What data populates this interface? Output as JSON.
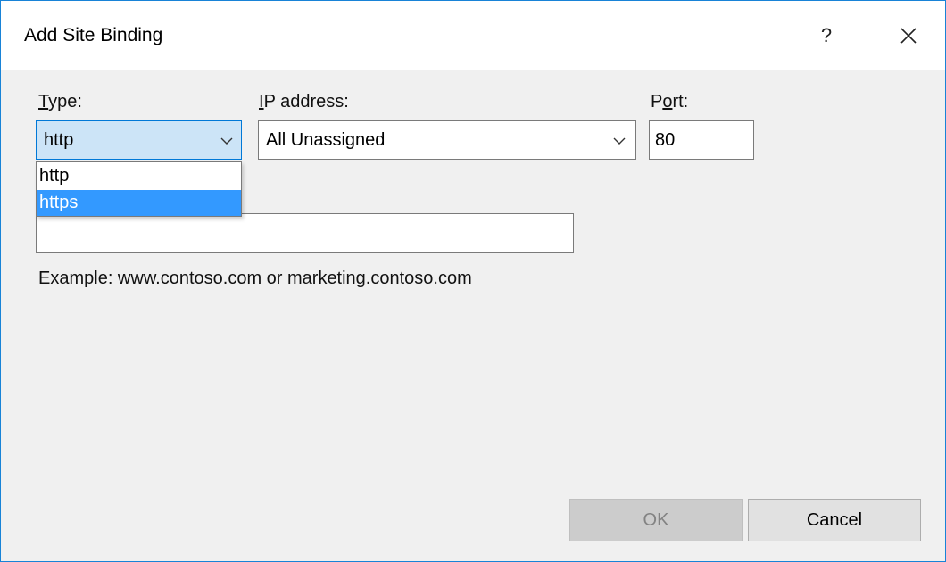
{
  "window": {
    "title": "Add Site Binding",
    "help_label": "?",
    "border_color": "#1883d7"
  },
  "type_field": {
    "label_mnemonic": "T",
    "label_rest": "ype:",
    "value": "http",
    "dropdown_open": true,
    "options": [
      "http",
      "https"
    ],
    "highlighted_option": "https"
  },
  "ip_field": {
    "label_mnemonic": "I",
    "label_rest": "P address:",
    "value": "All Unassigned"
  },
  "port_field": {
    "label_pre": "P",
    "label_mnemonic": "o",
    "label_rest": "rt:",
    "value": "80"
  },
  "host_field": {
    "value": ""
  },
  "example_text": "Example: www.contoso.com or marketing.contoso.com",
  "buttons": {
    "ok_label": "OK",
    "ok_enabled": false,
    "cancel_label": "Cancel"
  },
  "icons": {
    "close": "close-icon",
    "dropdown_arrow": "chevron-down-icon"
  },
  "colors": {
    "selection": "#3399ff",
    "focused_combo": "#cce4f7",
    "focus_border": "#0078d7"
  }
}
